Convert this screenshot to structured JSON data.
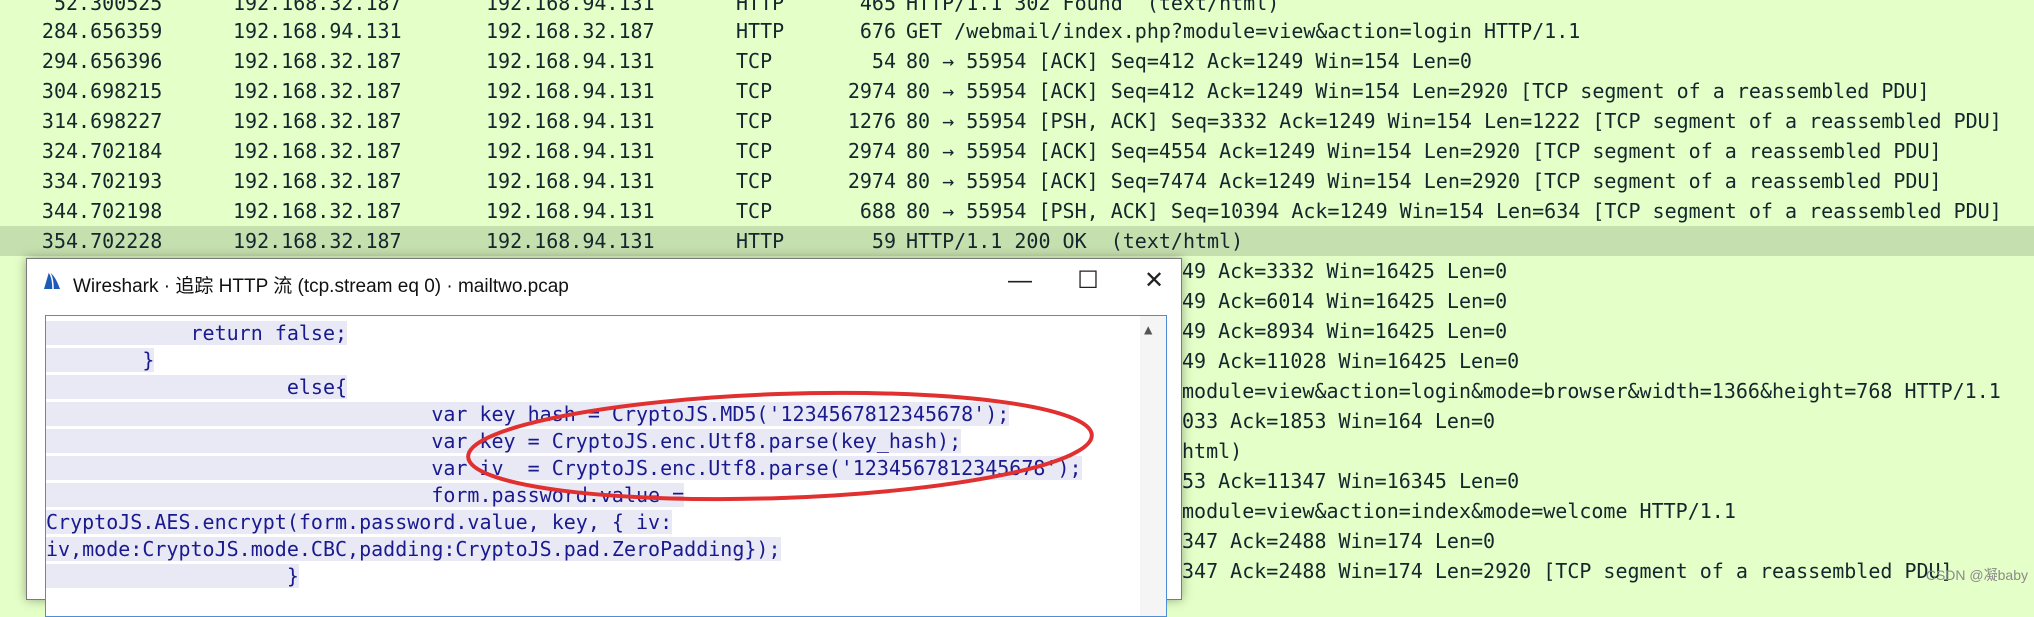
{
  "packets": [
    {
      "no": "5",
      "time": "2.300525",
      "src": "192.168.32.187",
      "dst": "192.168.94.131",
      "proto": "HTTP",
      "len": "465",
      "info": "HTTP/1.1 302 Found  (text/html)"
    },
    {
      "no": "28",
      "time": "4.656359",
      "src": "192.168.94.131",
      "dst": "192.168.32.187",
      "proto": "HTTP",
      "len": "676",
      "info": "GET /webmail/index.php?module=view&action=login HTTP/1.1"
    },
    {
      "no": "29",
      "time": "4.656396",
      "src": "192.168.32.187",
      "dst": "192.168.94.131",
      "proto": "TCP",
      "len": "54",
      "info": "80 → 55954 [ACK] Seq=412 Ack=1249 Win=154 Len=0"
    },
    {
      "no": "30",
      "time": "4.698215",
      "src": "192.168.32.187",
      "dst": "192.168.94.131",
      "proto": "TCP",
      "len": "2974",
      "info": "80 → 55954 [ACK] Seq=412 Ack=1249 Win=154 Len=2920 [TCP segment of a reassembled PDU]"
    },
    {
      "no": "31",
      "time": "4.698227",
      "src": "192.168.32.187",
      "dst": "192.168.94.131",
      "proto": "TCP",
      "len": "1276",
      "info": "80 → 55954 [PSH, ACK] Seq=3332 Ack=1249 Win=154 Len=1222 [TCP segment of a reassembled PDU]"
    },
    {
      "no": "32",
      "time": "4.702184",
      "src": "192.168.32.187",
      "dst": "192.168.94.131",
      "proto": "TCP",
      "len": "2974",
      "info": "80 → 55954 [ACK] Seq=4554 Ack=1249 Win=154 Len=2920 [TCP segment of a reassembled PDU]"
    },
    {
      "no": "33",
      "time": "4.702193",
      "src": "192.168.32.187",
      "dst": "192.168.94.131",
      "proto": "TCP",
      "len": "2974",
      "info": "80 → 55954 [ACK] Seq=7474 Ack=1249 Win=154 Len=2920 [TCP segment of a reassembled PDU]"
    },
    {
      "no": "34",
      "time": "4.702198",
      "src": "192.168.32.187",
      "dst": "192.168.94.131",
      "proto": "TCP",
      "len": "688",
      "info": "80 → 55954 [PSH, ACK] Seq=10394 Ack=1249 Win=154 Len=634 [TCP segment of a reassembled PDU]"
    },
    {
      "no": "35",
      "time": "4.702228",
      "src": "192.168.32.187",
      "dst": "192.168.94.131",
      "proto": "HTTP",
      "len": "59",
      "info": "HTTP/1.1 200 OK  (text/html)"
    }
  ],
  "partial_rows": [
    "49 Ack=3332 Win=16425 Len=0",
    "49 Ack=6014 Win=16425 Len=0",
    "49 Ack=8934 Win=16425 Len=0",
    "49 Ack=11028 Win=16425 Len=0",
    "module=view&action=login&mode=browser&width=1366&height=768 HTTP/1.1",
    "033 Ack=1853 Win=164 Len=0",
    "html)",
    "53 Ack=11347 Win=16345 Len=0",
    "module=view&action=index&mode=welcome HTTP/1.1",
    "347 Ack=2488 Win=174 Len=0",
    "347 Ack=2488 Win=174 Len=2920 [TCP segment of a reassembled PDU]"
  ],
  "dialog": {
    "title": "Wireshark · 追踪 HTTP 流 (tcp.stream eq 0) · mailtwo.pcap",
    "minimize": "—",
    "maximize": "☐",
    "close": "✕",
    "code_lines": [
      "            return false;",
      "        }",
      "                    else{",
      "                                var key_hash = CryptoJS.MD5('1234567812345678');",
      "                                var key = CryptoJS.enc.Utf8.parse(key_hash);",
      "                                var iv  = CryptoJS.enc.Utf8.parse('1234567812345678');",
      "                                form.password.value =",
      "CryptoJS.AES.encrypt(form.password.value, key, { iv:",
      "iv,mode:CryptoJS.mode.CBC,padding:CryptoJS.pad.ZeroPadding});",
      "                    }"
    ]
  },
  "watermark": "CSDN @凝baby",
  "colors": {
    "list_bg": "#e4ffc7",
    "selected_row": "#c6dfae",
    "annotation": "#e03030"
  }
}
